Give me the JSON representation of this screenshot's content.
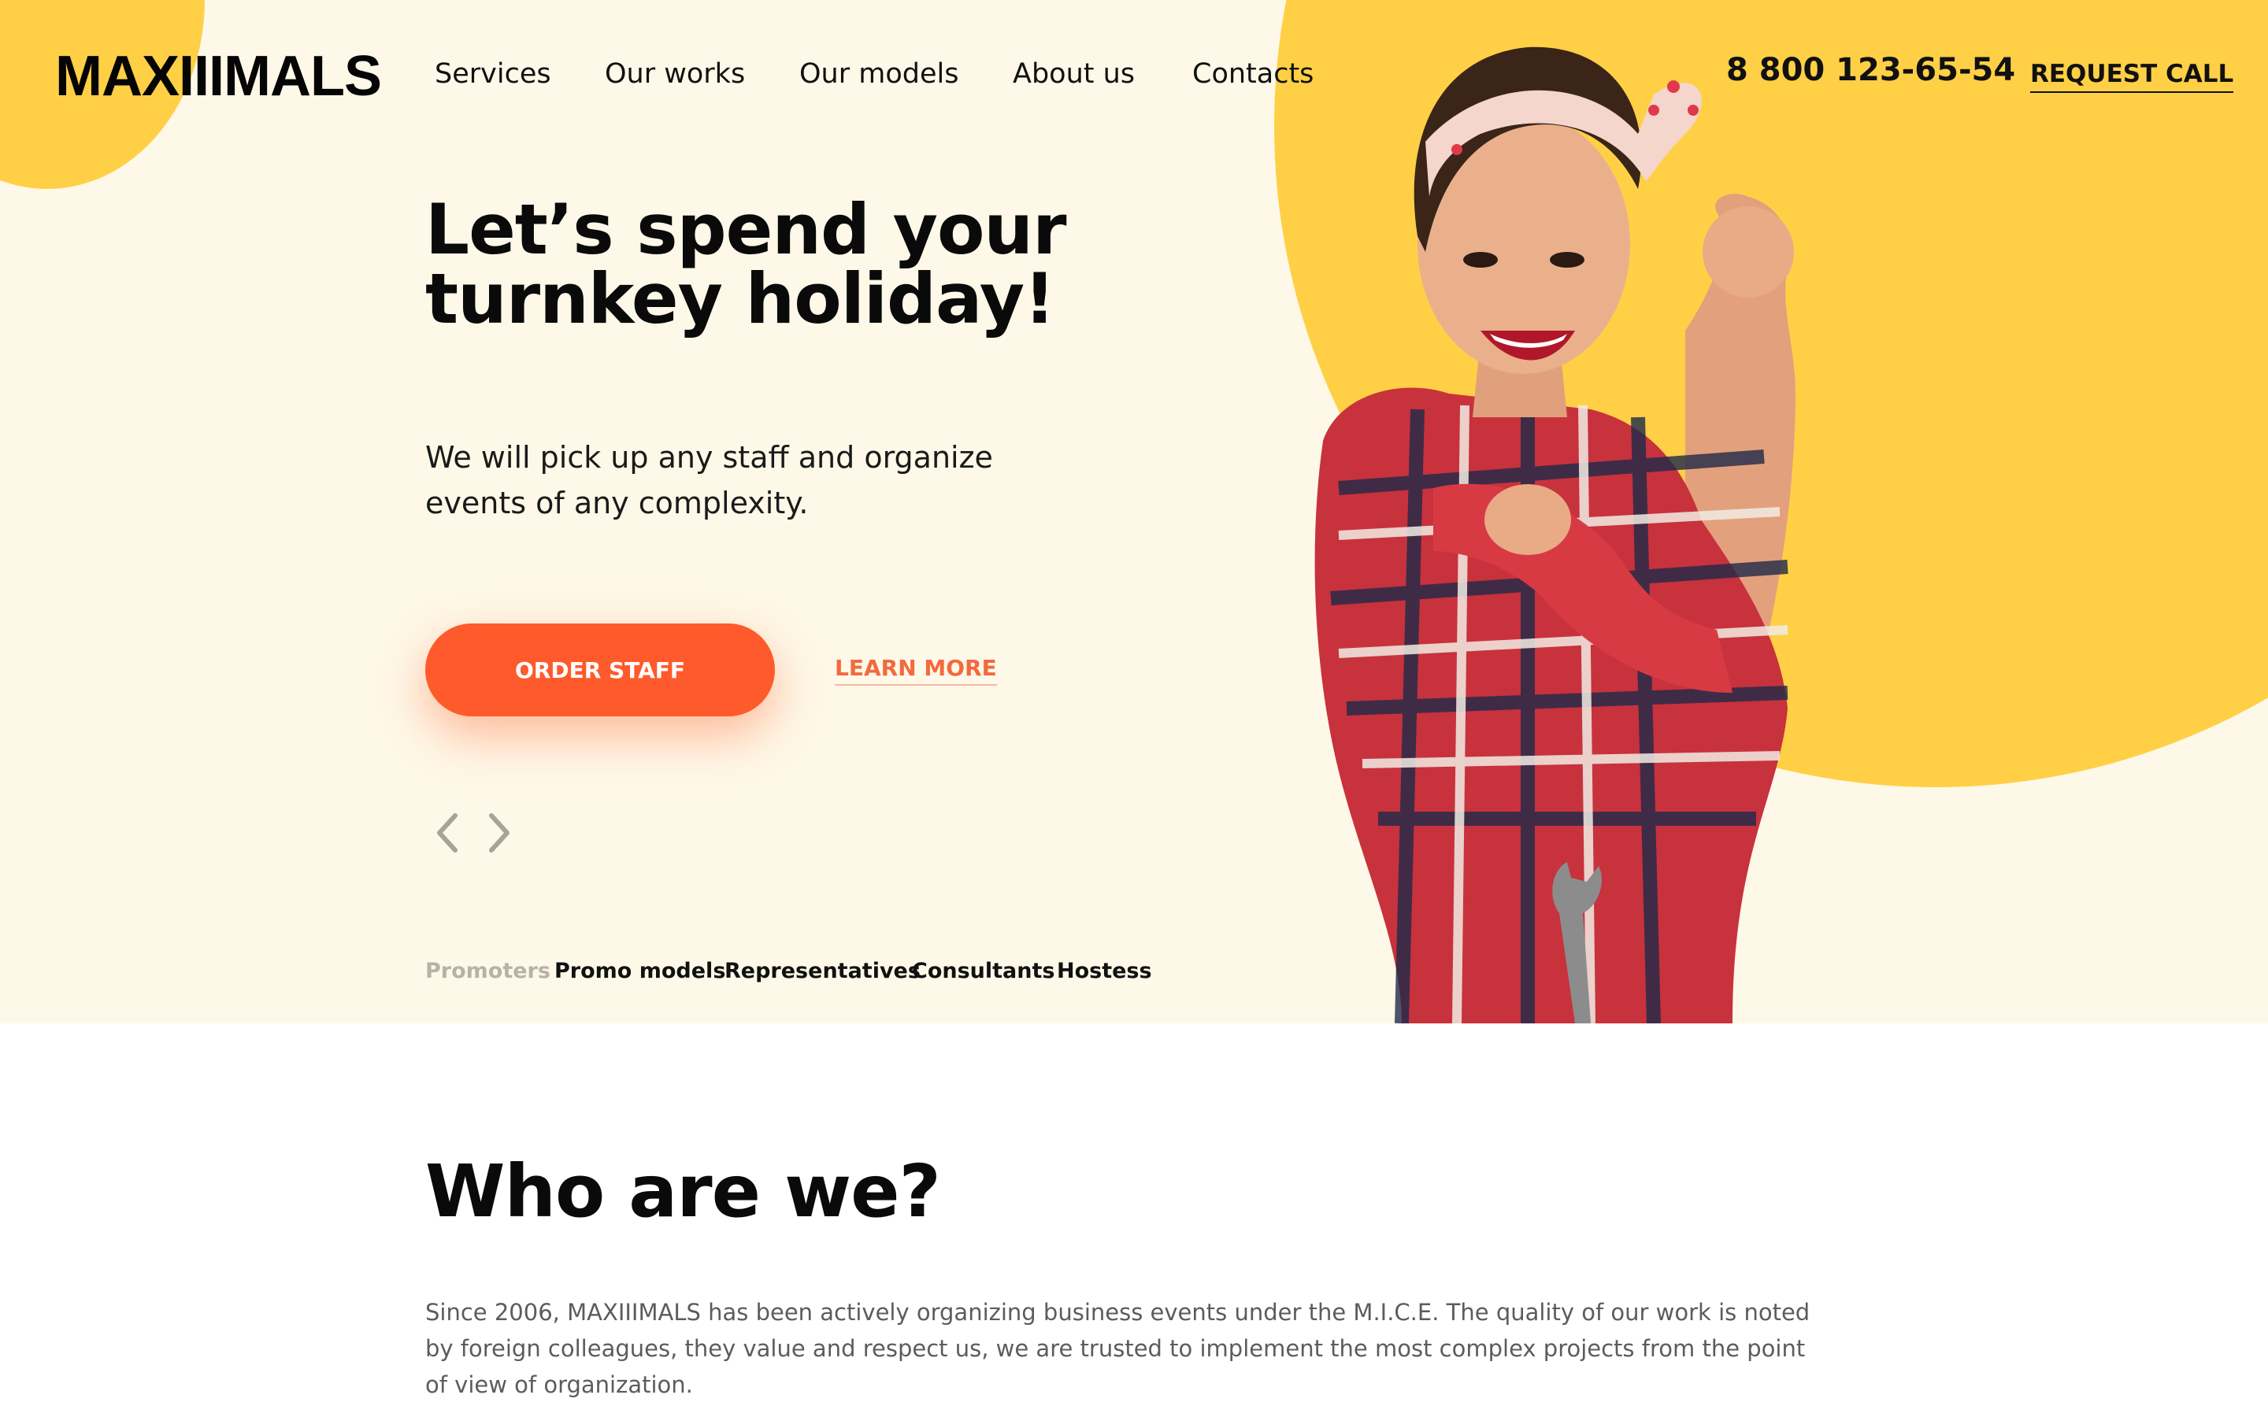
{
  "header": {
    "logo": "MAXIIIMALS",
    "nav": [
      "Services",
      "Our works",
      "Our models",
      "About us",
      "Contacts"
    ],
    "phone": "8 800 123-65-54",
    "request_call": "REQUEST CALL"
  },
  "hero": {
    "headline": "Let’s spend your turnkey holiday!",
    "subtext": "We will pick up any staff and organize events of any complexity.",
    "order_button": "ORDER STAFF",
    "learn_more": "LEARN MORE",
    "categories": [
      "Promoters",
      "Promo models",
      "Representatives",
      "Consultants",
      "Hostess"
    ],
    "active_category": "Promoters",
    "prev_icon": "chevron-left-icon",
    "next_icon": "chevron-right-icon"
  },
  "about": {
    "title": "Who are we?",
    "text": "Since 2006, MAXIIIMALS has been actively organizing business events under the M.I.C.E. The quality of our work is noted by foreign colleagues, they value and respect us, we are trusted to implement the most complex projects from the point of view of organization."
  },
  "colors": {
    "hero_background": "#fef8e8",
    "accent_yellow": "#ffd046",
    "accent_orange": "#ff5a2b",
    "text_dark": "#0f0f0f",
    "text_muted": "#5c5c5c"
  }
}
